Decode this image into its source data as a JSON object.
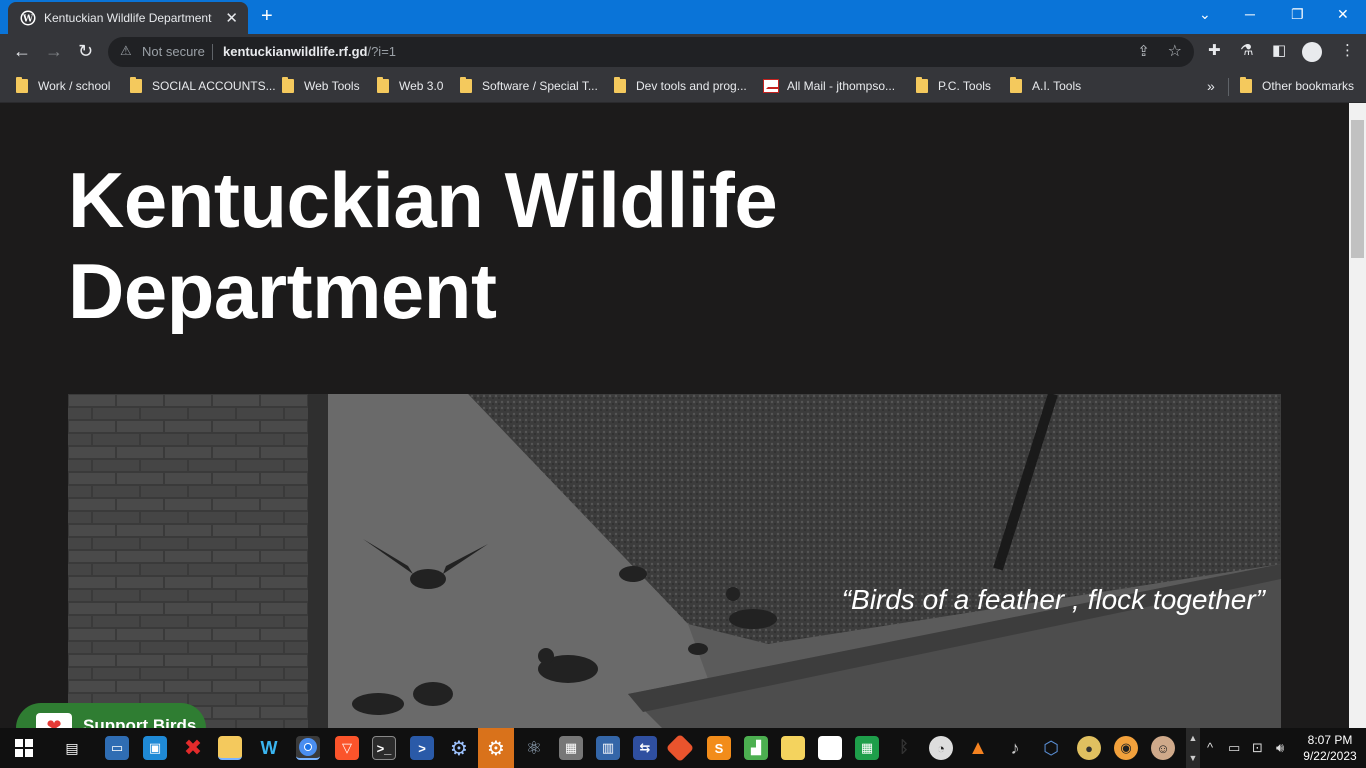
{
  "browser": {
    "tab_title": "Kentuckian Wildlife Department",
    "tab_close": "✕",
    "new_tab": "+",
    "security_label": "Not secure",
    "url_domain": "kentuckianwildlife.rf.gd",
    "url_path": "/?i=1",
    "bookmarks": [
      {
        "label": "Work / school",
        "icon": "folder-icon"
      },
      {
        "label": "SOCIAL ACCOUNTS...",
        "icon": "folder-icon"
      },
      {
        "label": "Web Tools",
        "icon": "folder-icon"
      },
      {
        "label": "Web 3.0",
        "icon": "folder-icon"
      },
      {
        "label": "Software / Special T...",
        "icon": "folder-icon"
      },
      {
        "label": "Dev tools and prog...",
        "icon": "folder-icon"
      },
      {
        "label": "All Mail - jthompso...",
        "icon": "gmail-icon"
      },
      {
        "label": "P.C. Tools",
        "icon": "folder-icon"
      },
      {
        "label": "A.I. Tools",
        "icon": "folder-icon"
      }
    ],
    "bookmarks_overflow": "»",
    "other_bookmarks": "Other bookmarks"
  },
  "page": {
    "headline_line1": "Kentuckian Wildlife",
    "headline_line2": "Department",
    "hero_quote": "“Birds of a feather , flock together”",
    "support_button": "Support Birds",
    "support_icon": "❤"
  },
  "taskbar": {
    "clock_time": "8:07 PM",
    "clock_date": "9/22/2023",
    "pinned_icons": [
      "start-icon",
      "task-view-icon",
      "computer-icon",
      "control-panel-icon",
      "close-x-app-icon",
      "file-explorer-icon",
      "wave-app-icon",
      "chrome-icon",
      "brave-icon",
      "terminal-icon",
      "powershell-icon",
      "settings-gear-icon",
      "settings-app-icon",
      "electron-icon",
      "package-icon",
      "network-icon",
      "remote-icon",
      "git-icon",
      "sublime-icon",
      "spreadsheet-icon",
      "files-icon",
      "document-icon",
      "sheets-icon",
      "bluetooth-icon",
      "clock-app-icon",
      "vlc-icon",
      "microphone-icon",
      "virtualbox-icon",
      "disc-icon",
      "eye-app-icon",
      "avatar-app-icon"
    ]
  },
  "colors": {
    "titlebar": "#0a74d8",
    "page_background": "#1c1b1b",
    "support_button": "#2f7d32",
    "folder": "#f4c95d"
  }
}
